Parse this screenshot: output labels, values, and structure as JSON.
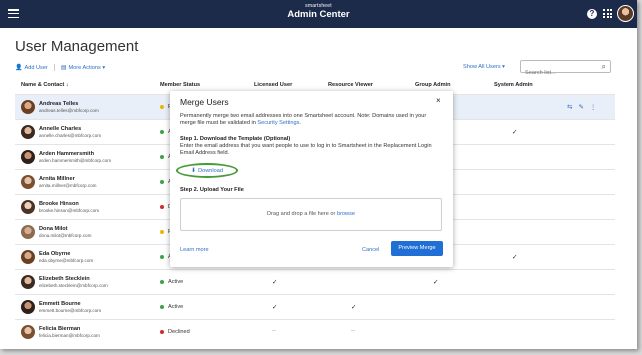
{
  "topbar": {
    "brand_small": "smartsheet",
    "brand_big": "Admin Center",
    "help_label": "?"
  },
  "page": {
    "title": "User Management"
  },
  "toolbar": {
    "add_user": "Add User",
    "more_actions": "More Actions ▾",
    "show_all": "Show All Users ▾",
    "search_placeholder": "Search list..."
  },
  "table": {
    "headers": [
      "Name & Contact ↓",
      "Member Status",
      "Licensed User",
      "Resource Viewer",
      "Group Admin",
      "System Admin"
    ],
    "rows": [
      {
        "name": "Andreas Telles",
        "email": "andreas.telles@mbfcorp.com",
        "status": "P",
        "status_color": "#f0b400"
      },
      {
        "name": "Annelle Charles",
        "email": "annelle.charles@mbfcorp.com",
        "status": "A",
        "status_color": "#3aa345"
      },
      {
        "name": "Arden Hammersmith",
        "email": "arden.hammersmith@mbfcorp.com",
        "status": "A",
        "status_color": "#3aa345"
      },
      {
        "name": "Arnita Millner",
        "email": "arnita.millner@mbfcorp.com",
        "status": "A",
        "status_color": "#3aa345"
      },
      {
        "name": "Brooke Hinson",
        "email": "brooke.hinson@mbfcorp.com",
        "status": "D",
        "status_color": "#d12b2b"
      },
      {
        "name": "Dona Milot",
        "email": "dona.milot@mbfcorp.com",
        "status": "P",
        "status_color": "#f0b400"
      },
      {
        "name": "Eda Obyrne",
        "email": "eda.obyrne@mbfcorp.com",
        "status": "A",
        "status_color": "#3aa345"
      },
      {
        "name": "Elizebeth Stecklein",
        "email": "elizebeth.stecklein@mbfcorp.com",
        "status": "Active",
        "status_color": "#3aa345"
      },
      {
        "name": "Emmett Bourne",
        "email": "emmett.bourne@mbfcorp.com",
        "status": "Active",
        "status_color": "#3aa345"
      },
      {
        "name": "Felicia Bierman",
        "email": "felicia.bierman@mbfcorp.com",
        "status": "Declined",
        "status_color": "#d12b2b"
      }
    ],
    "check": "✓",
    "dash": "--"
  },
  "modal": {
    "title": "Merge Users",
    "close": "×",
    "intro": "Permanently merge two email addresses into one Smartsheet account. Note: Domains used in your merge file must be validated in ",
    "intro_link": "Security Settings",
    "intro_end": ".",
    "step1": "Step 1. Download the Template (Optional)",
    "step1_desc": "Enter the email address that you want people to use to log in to Smartsheet in the Replacement Login Email Address field.",
    "download": "Download",
    "step2": "Step 2. Upload Your File",
    "drop_text": "Drag and drop a file here or ",
    "drop_link": "browse",
    "learn_more": "Learn more",
    "cancel": "Cancel",
    "preview": "Preview Merge"
  },
  "icons": {
    "download": "download-icon",
    "search": "search-icon",
    "add_user": "add-user-icon"
  }
}
